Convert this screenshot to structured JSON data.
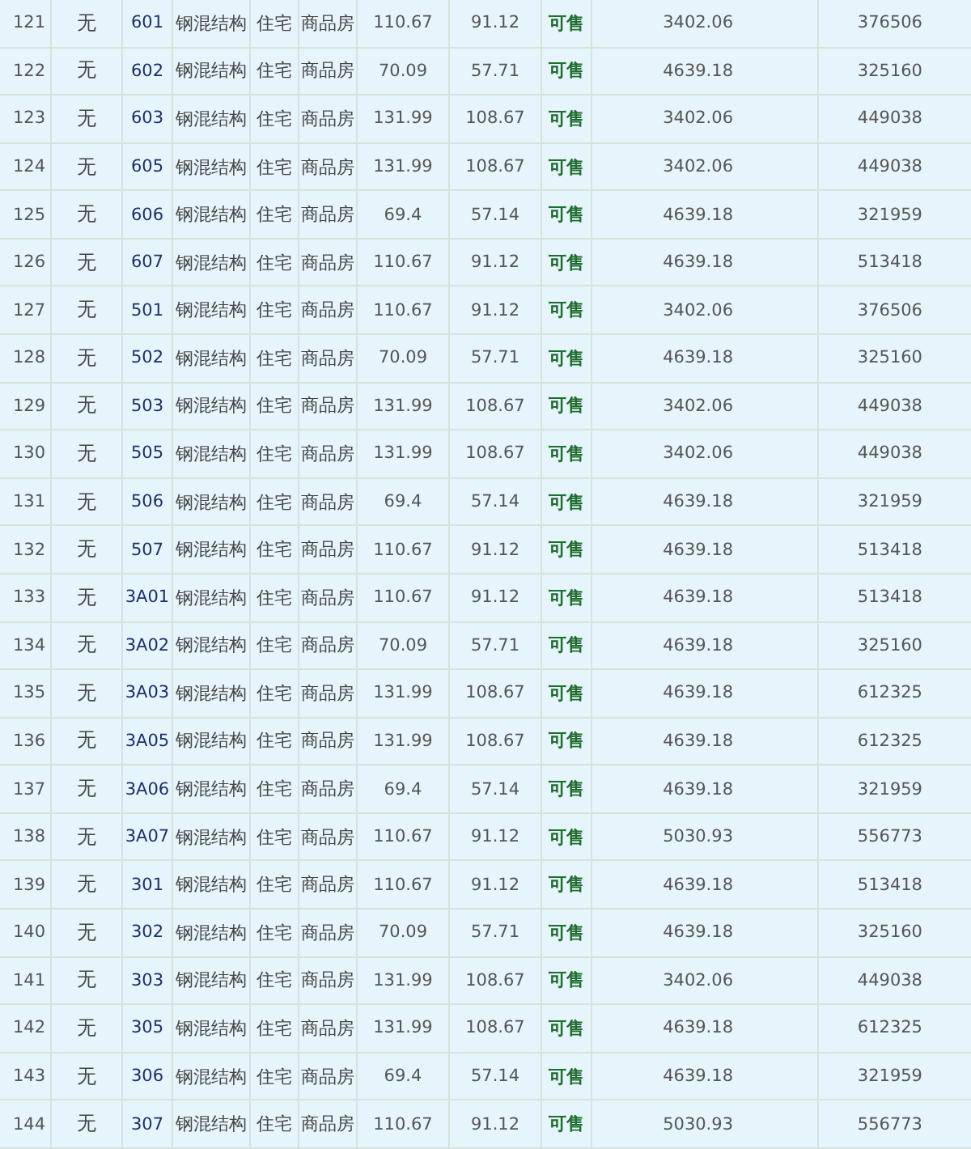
{
  "table": {
    "rows": [
      {
        "cells": [
          "121",
          "无",
          "601",
          "钢混结构",
          "住宅",
          "商品房",
          "110.67",
          "91.12",
          "可售",
          "3402.06",
          "376506"
        ]
      },
      {
        "cells": [
          "122",
          "无",
          "602",
          "钢混结构",
          "住宅",
          "商品房",
          "70.09",
          "57.71",
          "可售",
          "4639.18",
          "325160"
        ]
      },
      {
        "cells": [
          "123",
          "无",
          "603",
          "钢混结构",
          "住宅",
          "商品房",
          "131.99",
          "108.67",
          "可售",
          "3402.06",
          "449038"
        ]
      },
      {
        "cells": [
          "124",
          "无",
          "605",
          "钢混结构",
          "住宅",
          "商品房",
          "131.99",
          "108.67",
          "可售",
          "3402.06",
          "449038"
        ]
      },
      {
        "cells": [
          "125",
          "无",
          "606",
          "钢混结构",
          "住宅",
          "商品房",
          "69.4",
          "57.14",
          "可售",
          "4639.18",
          "321959"
        ]
      },
      {
        "cells": [
          "126",
          "无",
          "607",
          "钢混结构",
          "住宅",
          "商品房",
          "110.67",
          "91.12",
          "可售",
          "4639.18",
          "513418"
        ]
      },
      {
        "cells": [
          "127",
          "无",
          "501",
          "钢混结构",
          "住宅",
          "商品房",
          "110.67",
          "91.12",
          "可售",
          "3402.06",
          "376506"
        ]
      },
      {
        "cells": [
          "128",
          "无",
          "502",
          "钢混结构",
          "住宅",
          "商品房",
          "70.09",
          "57.71",
          "可售",
          "4639.18",
          "325160"
        ]
      },
      {
        "cells": [
          "129",
          "无",
          "503",
          "钢混结构",
          "住宅",
          "商品房",
          "131.99",
          "108.67",
          "可售",
          "3402.06",
          "449038"
        ]
      },
      {
        "cells": [
          "130",
          "无",
          "505",
          "钢混结构",
          "住宅",
          "商品房",
          "131.99",
          "108.67",
          "可售",
          "3402.06",
          "449038"
        ]
      },
      {
        "cells": [
          "131",
          "无",
          "506",
          "钢混结构",
          "住宅",
          "商品房",
          "69.4",
          "57.14",
          "可售",
          "4639.18",
          "321959"
        ]
      },
      {
        "cells": [
          "132",
          "无",
          "507",
          "钢混结构",
          "住宅",
          "商品房",
          "110.67",
          "91.12",
          "可售",
          "4639.18",
          "513418"
        ]
      },
      {
        "cells": [
          "133",
          "无",
          "3A01",
          "钢混结构",
          "住宅",
          "商品房",
          "110.67",
          "91.12",
          "可售",
          "4639.18",
          "513418"
        ]
      },
      {
        "cells": [
          "134",
          "无",
          "3A02",
          "钢混结构",
          "住宅",
          "商品房",
          "70.09",
          "57.71",
          "可售",
          "4639.18",
          "325160"
        ]
      },
      {
        "cells": [
          "135",
          "无",
          "3A03",
          "钢混结构",
          "住宅",
          "商品房",
          "131.99",
          "108.67",
          "可售",
          "4639.18",
          "612325"
        ]
      },
      {
        "cells": [
          "136",
          "无",
          "3A05",
          "钢混结构",
          "住宅",
          "商品房",
          "131.99",
          "108.67",
          "可售",
          "4639.18",
          "612325"
        ]
      },
      {
        "cells": [
          "137",
          "无",
          "3A06",
          "钢混结构",
          "住宅",
          "商品房",
          "69.4",
          "57.14",
          "可售",
          "4639.18",
          "321959"
        ]
      },
      {
        "cells": [
          "138",
          "无",
          "3A07",
          "钢混结构",
          "住宅",
          "商品房",
          "110.67",
          "91.12",
          "可售",
          "5030.93",
          "556773"
        ]
      },
      {
        "cells": [
          "139",
          "无",
          "301",
          "钢混结构",
          "住宅",
          "商品房",
          "110.67",
          "91.12",
          "可售",
          "4639.18",
          "513418"
        ]
      },
      {
        "cells": [
          "140",
          "无",
          "302",
          "钢混结构",
          "住宅",
          "商品房",
          "70.09",
          "57.71",
          "可售",
          "4639.18",
          "325160"
        ]
      },
      {
        "cells": [
          "141",
          "无",
          "303",
          "钢混结构",
          "住宅",
          "商品房",
          "131.99",
          "108.67",
          "可售",
          "3402.06",
          "449038"
        ]
      },
      {
        "cells": [
          "142",
          "无",
          "305",
          "钢混结构",
          "住宅",
          "商品房",
          "131.99",
          "108.67",
          "可售",
          "4639.18",
          "612325"
        ]
      },
      {
        "cells": [
          "143",
          "无",
          "306",
          "钢混结构",
          "住宅",
          "商品房",
          "69.4",
          "57.14",
          "可售",
          "4639.18",
          "321959"
        ]
      },
      {
        "cells": [
          "144",
          "无",
          "307",
          "钢混结构",
          "住宅",
          "商品房",
          "110.67",
          "91.12",
          "可售",
          "5030.93",
          "556773"
        ]
      }
    ]
  }
}
